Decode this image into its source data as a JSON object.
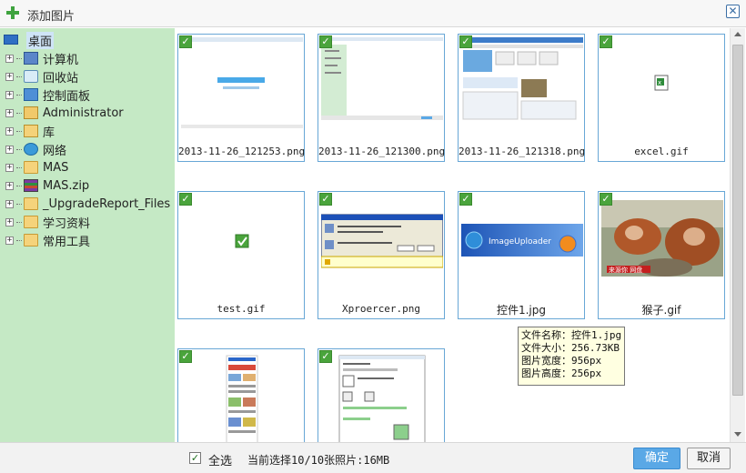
{
  "title": "添加图片",
  "close_glyph": "✕",
  "sidebar": {
    "root": {
      "label": "桌面",
      "icon": "monitor-icon"
    },
    "items": [
      {
        "label": "计算机",
        "icon": "computer-icon"
      },
      {
        "label": "回收站",
        "icon": "recycle-bin-icon"
      },
      {
        "label": "控制面板",
        "icon": "control-panel-icon"
      },
      {
        "label": "Administrator",
        "icon": "user-folder-icon"
      },
      {
        "label": "库",
        "icon": "library-icon"
      },
      {
        "label": "网络",
        "icon": "network-icon"
      },
      {
        "label": "MAS",
        "icon": "folder-icon"
      },
      {
        "label": "MAS.zip",
        "icon": "zip-archive-icon"
      },
      {
        "label": "_UpgradeReport_Files",
        "icon": "folder-icon"
      },
      {
        "label": "学习资料",
        "icon": "folder-icon"
      },
      {
        "label": "常用工具",
        "icon": "folder-icon"
      }
    ],
    "expand_glyph": "+"
  },
  "images": [
    {
      "name": "2013-11-26_121253.png",
      "checked": true
    },
    {
      "name": "2013-11-26_121300.png",
      "checked": true
    },
    {
      "name": "2013-11-26_121318.png",
      "checked": true
    },
    {
      "name": "excel.gif",
      "checked": true
    },
    {
      "name": "test.gif",
      "checked": true
    },
    {
      "name": "Xproercer.png",
      "checked": true
    },
    {
      "name": "控件1.jpg",
      "checked": true
    },
    {
      "name": "猴子.gif",
      "checked": true
    },
    {
      "name": "",
      "checked": true
    },
    {
      "name": "",
      "checked": true
    }
  ],
  "check_glyph": "✓",
  "thumb_texts": {
    "uploader_brand": "ImageUploader",
    "monkey_caption": "来源你 网盘"
  },
  "tooltip": {
    "line1": "文件名称：控件1.jpg",
    "line2": "文件大小：256.73KB",
    "line3": "图片宽度：956px",
    "line4": "图片高度：256px"
  },
  "footer": {
    "select_all_label": "全选",
    "status": "当前选择10/10张照片:16MB",
    "ok_label": "确定",
    "cancel_label": "取消"
  },
  "colors": {
    "sidebar_bg": "#c5e9c5",
    "card_border": "#68a7d6",
    "check_green": "#4aa43c",
    "ok_button": "#5aa8e6"
  }
}
